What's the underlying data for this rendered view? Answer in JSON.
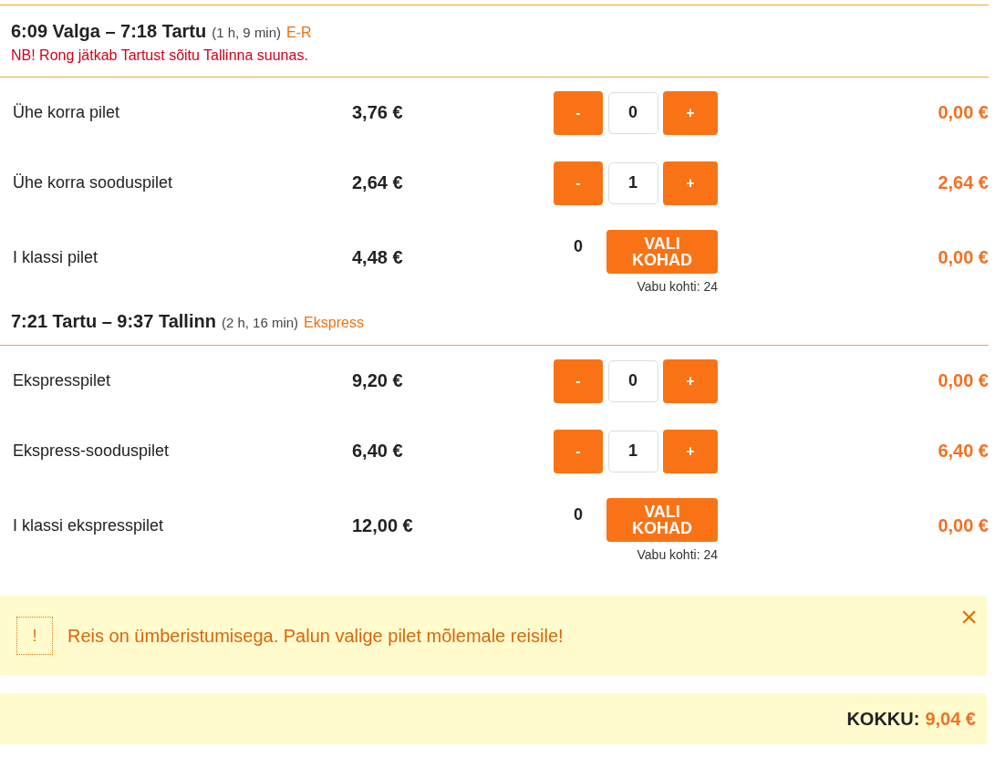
{
  "segments": [
    {
      "route": "6:09 Valga – 7:18 Tartu",
      "duration": "(1 h, 9 min)",
      "operator": "E-R",
      "note": "NB! Rong jätkab Tartust sõitu Tallinna suunas.",
      "tickets": [
        {
          "kind": "counter",
          "name": "Ühe korra pilet",
          "price": "3,76 €",
          "minus": "-",
          "quantity": "0",
          "plus": "+",
          "total": "0,00 €"
        },
        {
          "kind": "counter",
          "name": "Ühe korra sooduspilet",
          "price": "2,64 €",
          "minus": "-",
          "quantity": "1",
          "plus": "+",
          "total": "2,64 €"
        },
        {
          "kind": "seats",
          "name": "I klassi pilet",
          "price": "4,48 €",
          "quantity": "0",
          "button": "VALI KOHAD",
          "seats": "Vabu kohti: 24",
          "total": "0,00 €"
        }
      ]
    },
    {
      "route": "7:21 Tartu – 9:37 Tallinn",
      "duration": "(2 h, 16 min)",
      "operator": "Ekspress",
      "tickets": [
        {
          "kind": "counter",
          "name": "Ekspresspilet",
          "price": "9,20 €",
          "minus": "-",
          "quantity": "0",
          "plus": "+",
          "total": "0,00 €"
        },
        {
          "kind": "counter",
          "name": "Ekspress-sooduspilet",
          "price": "6,40 €",
          "minus": "-",
          "quantity": "1",
          "plus": "+",
          "total": "6,40 €"
        },
        {
          "kind": "seats",
          "name": "I klassi ekspresspilet",
          "price": "12,00 €",
          "quantity": "0",
          "button": "VALI KOHAD",
          "seats": "Vabu kohti: 24",
          "total": "0,00 €"
        }
      ]
    }
  ],
  "alert": {
    "icon": "!",
    "message": "Reis on ümberistumisega. Palun valige pilet mõlemale reisile!",
    "close": "×"
  },
  "summary": {
    "label": "KOKKU:",
    "value": "9,04 €"
  }
}
